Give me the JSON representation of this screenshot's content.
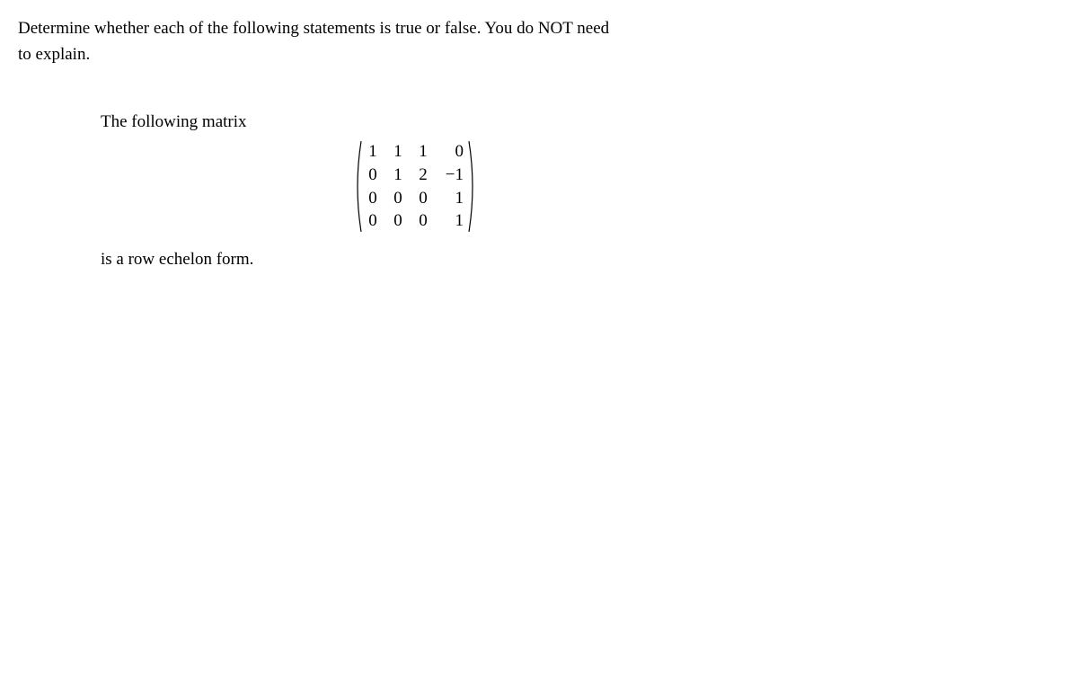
{
  "instruction": {
    "line1": "Determine whether each of the following statements is true or false. You do NOT need",
    "line2": "to explain."
  },
  "problem": {
    "intro": "The following matrix",
    "outro": "is a row echelon form.",
    "matrix": {
      "rows": [
        [
          "1",
          "1",
          "1",
          "0"
        ],
        [
          "0",
          "1",
          "2",
          "−1"
        ],
        [
          "0",
          "0",
          "0",
          "1"
        ],
        [
          "0",
          "0",
          "0",
          "1"
        ]
      ]
    }
  }
}
